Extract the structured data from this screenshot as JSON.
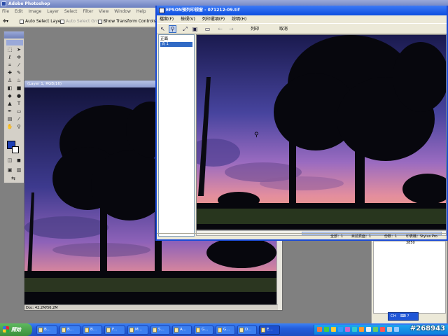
{
  "photoshop": {
    "title": "Adobe Photoshop",
    "menu": [
      "File",
      "Edit",
      "Image",
      "Layer",
      "Select",
      "Filter",
      "View",
      "Window",
      "Help"
    ],
    "options": {
      "auto_select_layer": "Auto Select Layer",
      "auto_select_groups": "Auto Select Groups",
      "show_transform_controls": "Show Transform Controls"
    },
    "document": {
      "title": "(Layer 1, RGB/16)",
      "status": "Doc: 42.2M/56.2M"
    }
  },
  "epson": {
    "title": "EPSON預列印視窗 - 071212-09.tif",
    "menu": [
      "檔案(F)",
      "檢視(V)",
      "列印選項(P)",
      "說明(H)"
    ],
    "toolbar": {
      "print_label": "列印",
      "cancel_label": "取消"
    },
    "panel": {
      "header": "正面",
      "item": "頁 1"
    },
    "status": {
      "all": "全部：1",
      "current": "目前頁面：1",
      "copies": "份數：1",
      "printer": "印表機：Stylus Pro 3850"
    }
  },
  "ime": {
    "label": "CH"
  },
  "taskbar": {
    "start_label": "開始",
    "tasks": [
      "B...",
      "B...",
      "B...",
      "F...",
      "M...",
      "S...",
      "A...",
      "G...",
      "G...",
      "D...",
      "E..."
    ]
  },
  "watermark": "#268943",
  "colors": {
    "foreground": "#1d3fb5",
    "background": "#ffffff",
    "xp_blue": "#245edb"
  }
}
